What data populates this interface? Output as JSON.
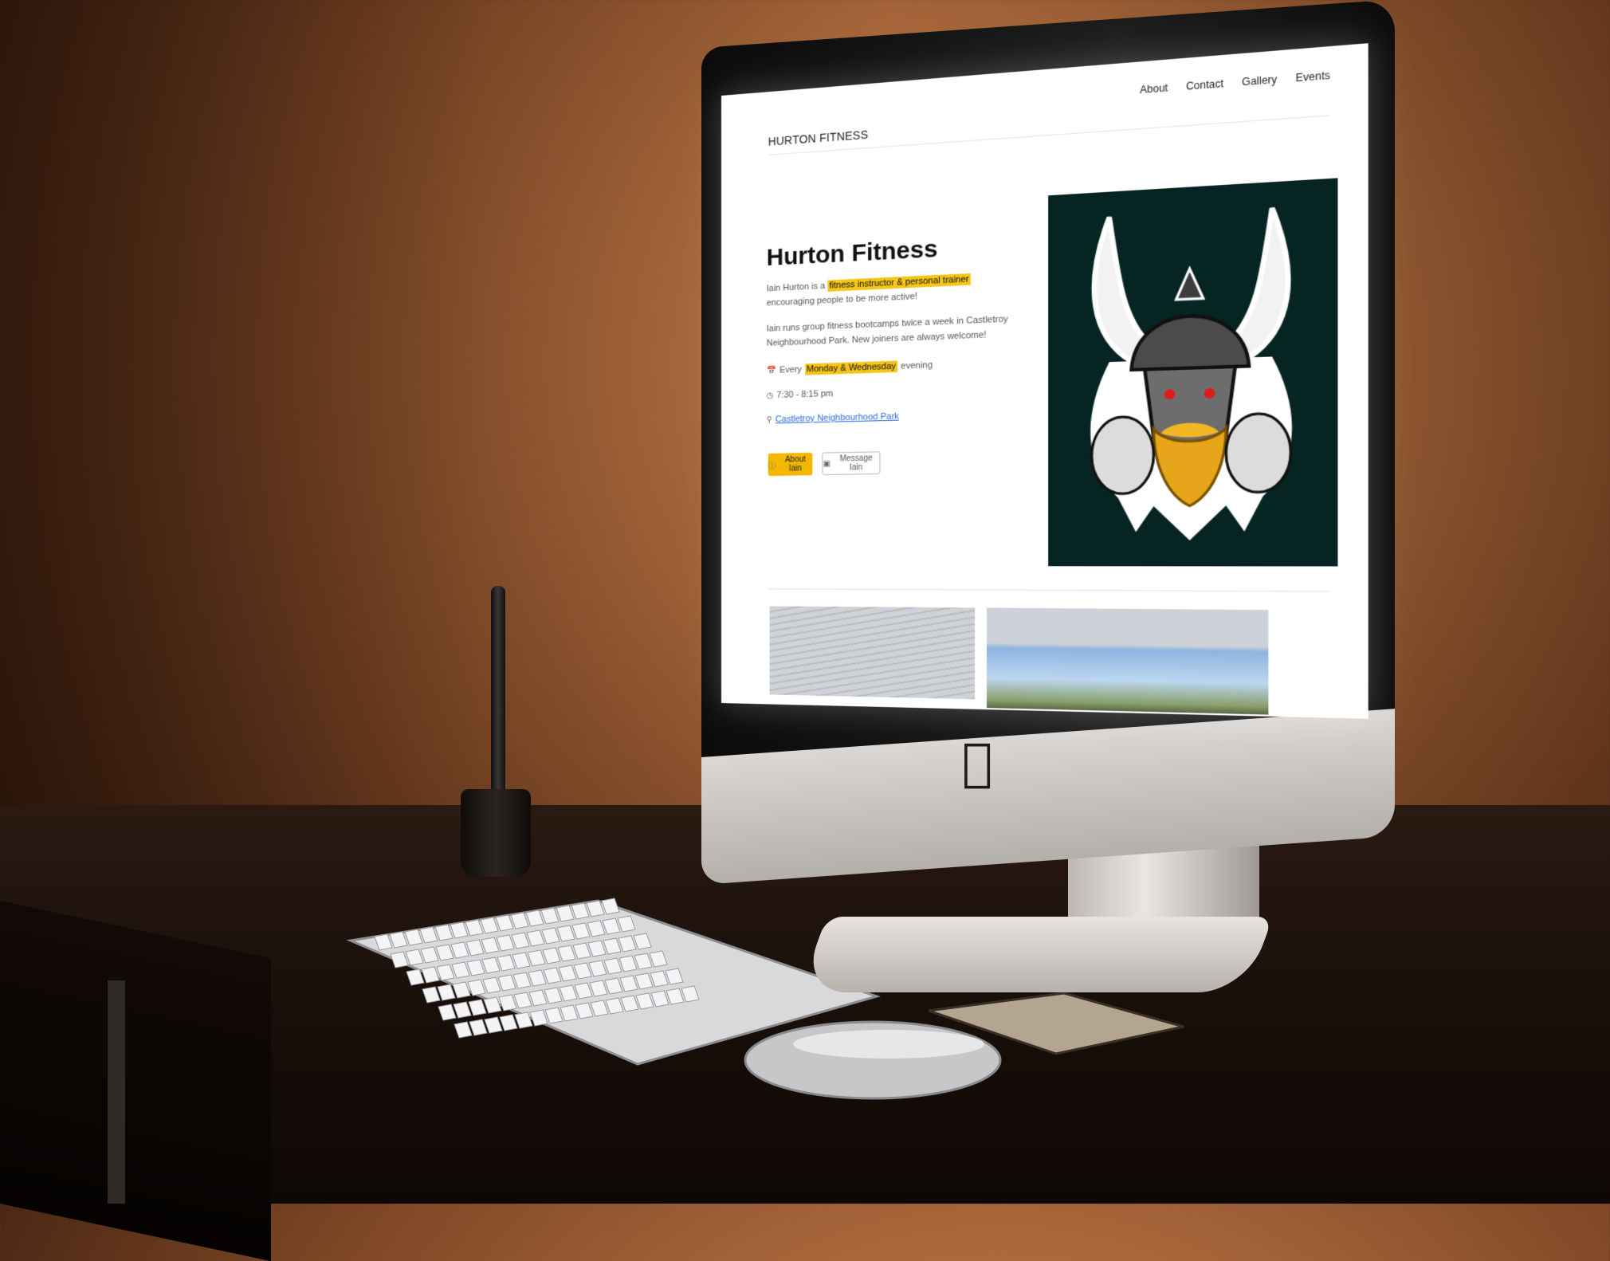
{
  "site": {
    "brand": "HURTON FITNESS",
    "nav": [
      "About",
      "Contact",
      "Gallery",
      "Events"
    ]
  },
  "hero": {
    "title": "Hurton Fitness",
    "p1_before": "Iain Hurton is a ",
    "p1_highlight": "fitness instructor & personal trainer",
    "p1_after": " encouraging people to be more active!",
    "p2": "Iain runs group fitness bootcamps twice a week in Castletroy Neighbourhood Park. New joiners are always welcome!",
    "schedule_before": "Every ",
    "schedule_highlight": "Monday & Wednesday",
    "schedule_after": " evening",
    "time": "7:30 - 8:15 pm",
    "location": "Castletroy Neighbourhood Park",
    "btn_about": "About Iain",
    "btn_message": "Message Iain"
  },
  "icons": {
    "calendar": "calendar-icon",
    "clock": "clock-icon",
    "location": "location-pin-icon",
    "info": "info-icon",
    "instagram": "instagram-icon",
    "apple": "apple-logo-icon"
  },
  "colors": {
    "accent": "#f5b800",
    "highlight": "#f5c518",
    "link": "#2a6ae0",
    "mascot_bg": "#062422"
  }
}
